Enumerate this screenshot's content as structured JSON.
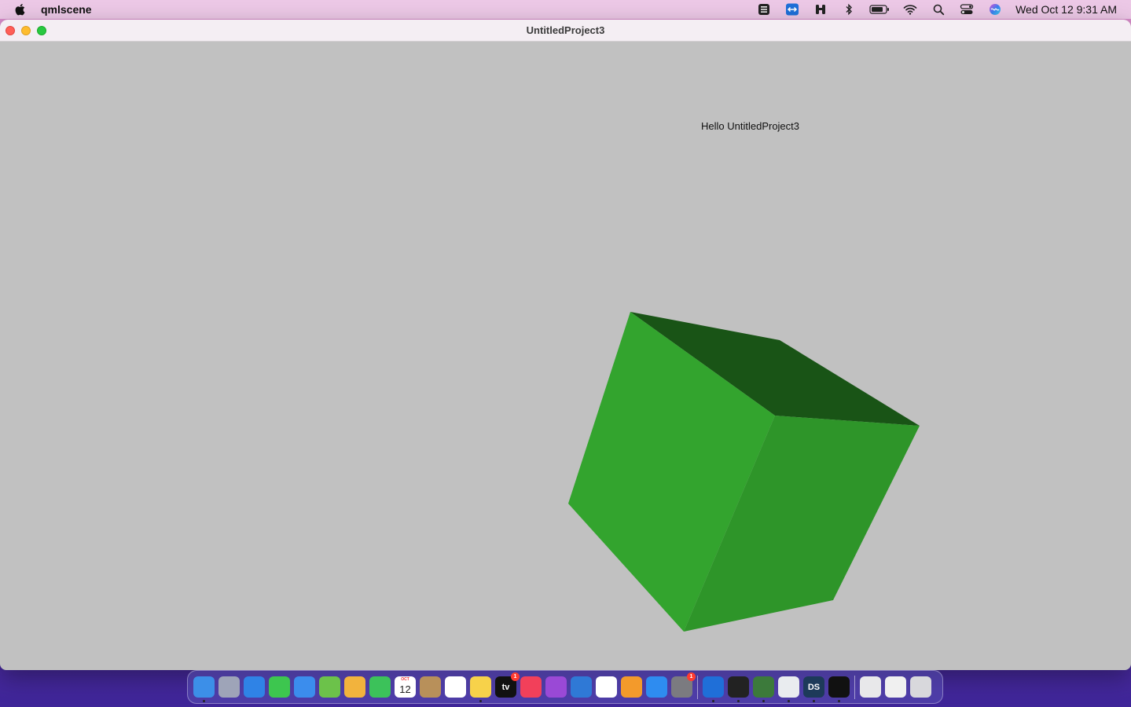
{
  "menubar": {
    "app_name": "qmlscene",
    "clock": "Wed Oct 12  9:31 AM",
    "status_icons": [
      "keyboard-layout-icon",
      "teamviewer-icon",
      "binoculars-icon",
      "bluetooth-icon",
      "battery-icon",
      "wifi-icon",
      "spotlight-search-icon",
      "control-center-icon",
      "siri-icon"
    ]
  },
  "window": {
    "title": "UntitledProject3",
    "greeting": "Hello UntitledProject3"
  },
  "cube": {
    "colors": {
      "front": "#33a42e",
      "side": "#2e9529",
      "top": "#195416"
    }
  },
  "dock": {
    "items": [
      {
        "name": "finder-icon",
        "color": "#3c8fe8",
        "running": true
      },
      {
        "name": "launchpad-icon",
        "color": "#9ea4b8"
      },
      {
        "name": "safari-icon",
        "color": "#2f83e6"
      },
      {
        "name": "messages-icon",
        "color": "#3dc64f"
      },
      {
        "name": "mail-icon",
        "color": "#3b8ded"
      },
      {
        "name": "maps-icon",
        "color": "#6cc24a"
      },
      {
        "name": "photos-icon",
        "color": "#f2b33d"
      },
      {
        "name": "facetime-icon",
        "color": "#3cc25a"
      },
      {
        "name": "calendar-icon",
        "color": "#ffffff",
        "label_top": "OCT",
        "label": "12"
      },
      {
        "name": "contacts-icon",
        "color": "#b8905a"
      },
      {
        "name": "reminders-icon",
        "color": "#ffffff"
      },
      {
        "name": "notes-icon",
        "color": "#f7d24a",
        "running": true
      },
      {
        "name": "apple-tv-icon",
        "color": "#111111",
        "label": "tv",
        "badge": "1"
      },
      {
        "name": "music-icon",
        "color": "#f2405a"
      },
      {
        "name": "podcasts-icon",
        "color": "#9a49d6"
      },
      {
        "name": "keynote-icon",
        "color": "#2f79d6"
      },
      {
        "name": "numbers-icon",
        "color": "#ffffff"
      },
      {
        "name": "pages-icon",
        "color": "#f39a2b"
      },
      {
        "name": "app-store-icon",
        "color": "#2e8cf0"
      },
      {
        "name": "system-preferences-icon",
        "color": "#7b7b80",
        "badge": "1"
      }
    ],
    "items_right": [
      {
        "name": "teamviewer-dock-icon",
        "color": "#1f6fd8",
        "running": true
      },
      {
        "name": "terminal-icon",
        "color": "#222222",
        "running": true
      },
      {
        "name": "qt-design-icon",
        "color": "#3c7a3b",
        "running": true
      },
      {
        "name": "java-icon",
        "color": "#e9ecef",
        "running": true
      },
      {
        "name": "qt-design-studio-icon",
        "color": "#1d3a5a",
        "label": "DS",
        "running": true
      },
      {
        "name": "console-icon",
        "color": "#111111",
        "running": true
      }
    ],
    "items_end": [
      {
        "name": "documents-folder-icon",
        "color": "#e8e8ea"
      },
      {
        "name": "screen-sharing-icon",
        "color": "#f0f0f0"
      },
      {
        "name": "trash-icon",
        "color": "#d8d8dc"
      }
    ]
  }
}
